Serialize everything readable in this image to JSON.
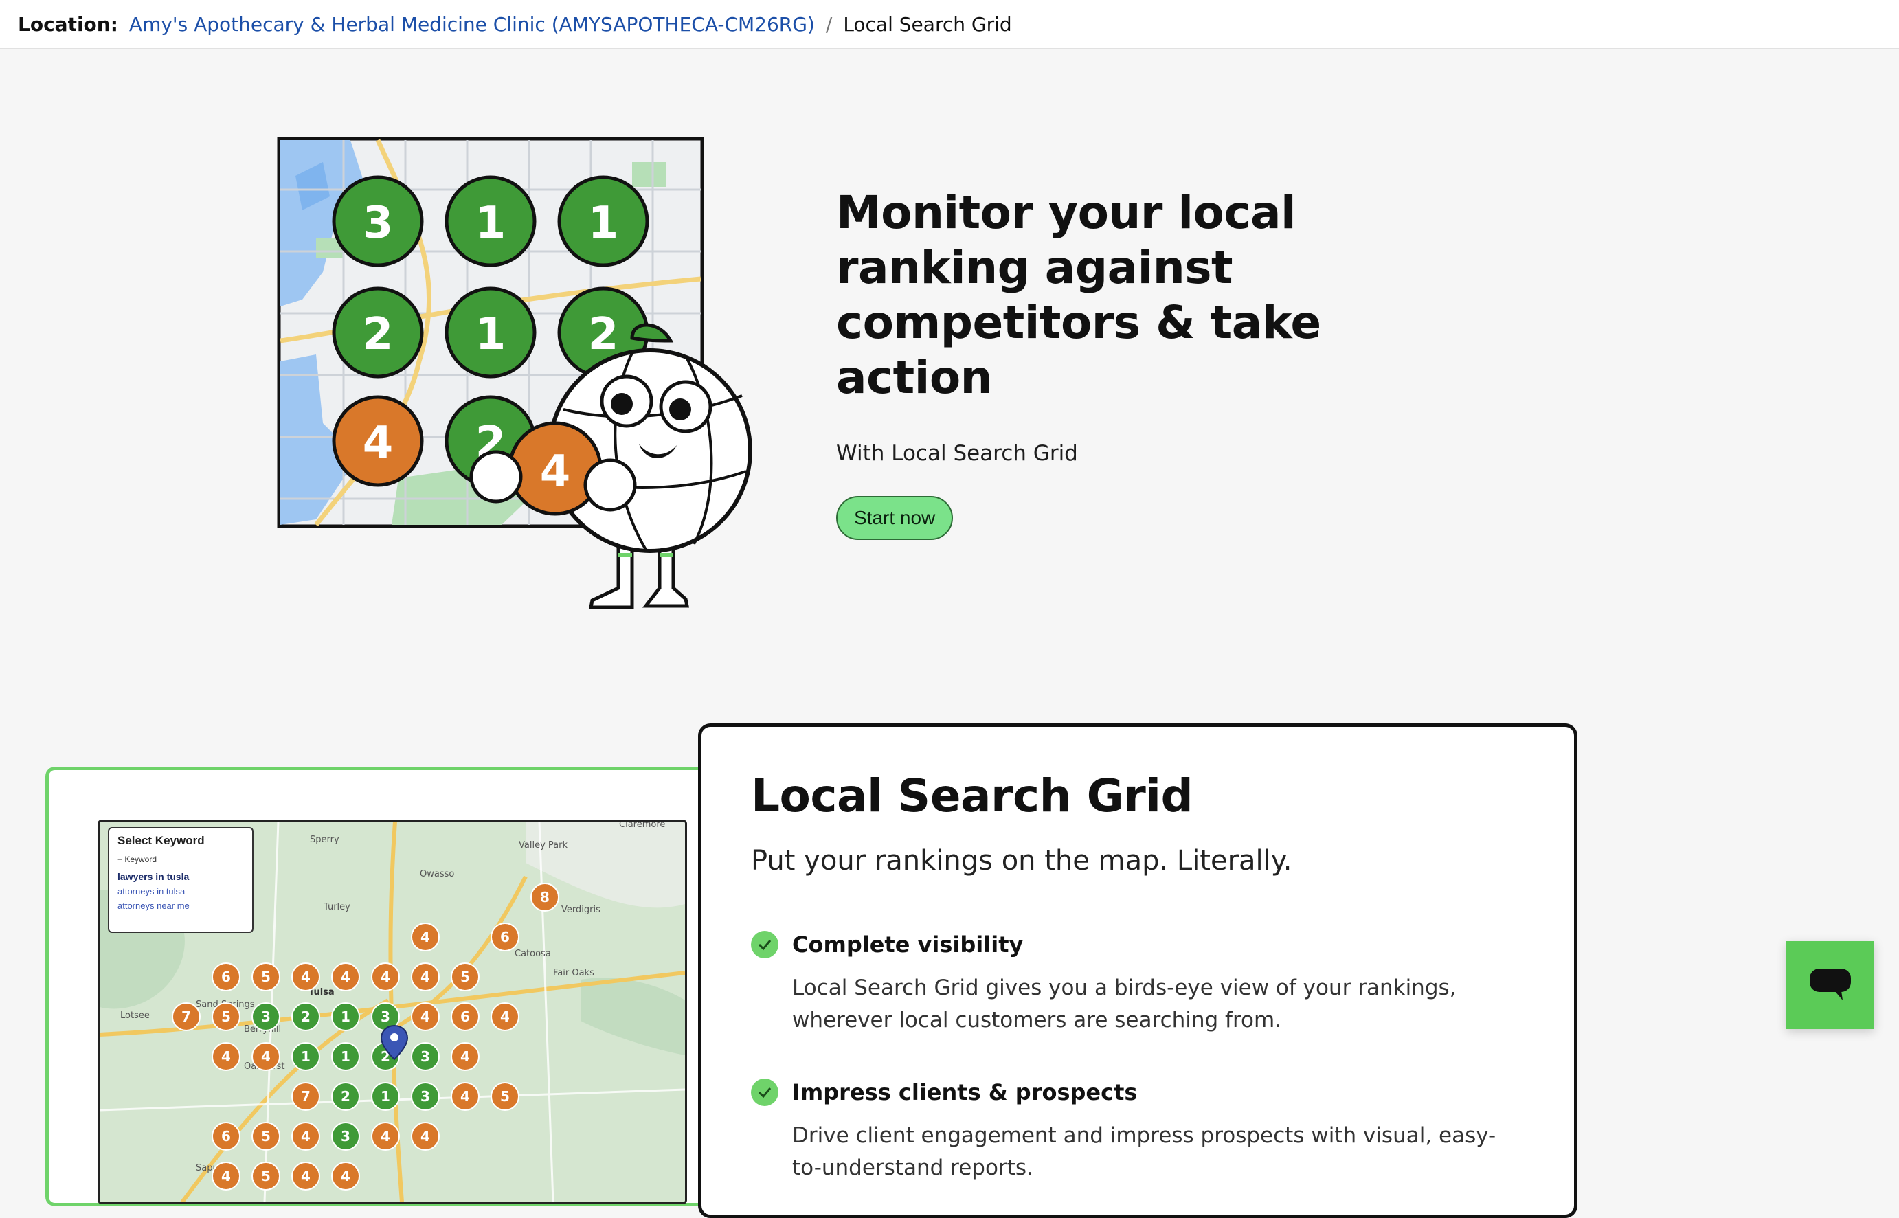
{
  "breadcrumb": {
    "label": "Location:",
    "location_link": "Amy's Apothecary & Herbal Medicine Clinic (AMYSAPOTHECA-CM26RG)",
    "separator": "/",
    "current": "Local Search Grid"
  },
  "hero": {
    "title": "Monitor your local ranking against competitors & take action",
    "subtitle": "With Local Search Grid",
    "cta_label": "Start now",
    "illustration_grid": [
      {
        "value": "3",
        "status": "green"
      },
      {
        "value": "1",
        "status": "green"
      },
      {
        "value": "1",
        "status": "green"
      },
      {
        "value": "2",
        "status": "green"
      },
      {
        "value": "1",
        "status": "green"
      },
      {
        "value": "2",
        "status": "green"
      },
      {
        "value": "4",
        "status": "orange"
      },
      {
        "value": "2",
        "status": "green"
      }
    ],
    "mascot_pin_value": "4"
  },
  "preview": {
    "keyword_panel": {
      "title": "Select Keyword",
      "subtitle": "+ Keyword",
      "options": [
        "lawyers in tusla",
        "attorneys in tulsa",
        "attorneys near me"
      ],
      "selected": "lawyers in tusla"
    },
    "map_labels": [
      "Sperry",
      "Valley Park",
      "Owasso",
      "Turley",
      "Verdigris",
      "Fair Oaks",
      "Tulsa",
      "Sand Springs",
      "Lotsee",
      "Oakhurst",
      "Berryhill",
      "Sapulpa",
      "Catoosa",
      "Claremore"
    ],
    "rank_grid": [
      [
        "",
        "",
        "",
        "",
        "8",
        "",
        "",
        "",
        ""
      ],
      [
        "",
        "",
        "4",
        "",
        "6",
        "",
        "",
        "",
        ""
      ],
      [
        "6",
        "5",
        "4",
        "4",
        "4",
        "4",
        "5",
        "",
        ""
      ],
      [
        "7",
        "5",
        "3",
        "2",
        "1",
        "3",
        "4",
        "6",
        "4"
      ],
      [
        "4",
        "4",
        "1",
        "1",
        "2",
        "3",
        "4",
        "",
        ""
      ],
      [
        "",
        "7",
        "2",
        "1",
        "3",
        "4",
        "5",
        "",
        ""
      ],
      [
        "6",
        "5",
        "4",
        "3",
        "4",
        "4",
        "",
        "",
        ""
      ],
      [
        "4",
        "5",
        "4",
        "4",
        "",
        "",
        "",
        "",
        ""
      ]
    ]
  },
  "info": {
    "title": "Local Search Grid",
    "subtitle": "Put your rankings on the map. Literally.",
    "features": [
      {
        "title": "Complete visibility",
        "description": "Local Search Grid gives you a birds-eye view of your rankings, wherever local customers are searching from."
      },
      {
        "title": "Impress clients & prospects",
        "description": "Drive client engagement and impress prospects with visual, easy-to-understand reports."
      }
    ]
  },
  "colors": {
    "accent_green": "#6fd36a",
    "rank_green": "#3f9a37",
    "rank_orange": "#d9782a",
    "link_blue": "#1c4fa8"
  },
  "icons": {
    "feature_check": "check-circle-icon",
    "chat": "chat-bubble-icon"
  }
}
